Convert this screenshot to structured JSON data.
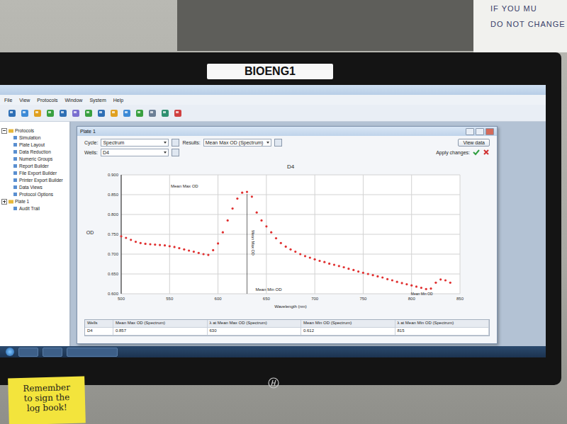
{
  "monitor_label": "BIOENG1",
  "wall_note": [
    "IF YOU MU",
    "DO NOT CHANGE"
  ],
  "menu": [
    "File",
    "View",
    "Protocols",
    "Window",
    "System",
    "Help"
  ],
  "tree": [
    {
      "label": "Protocols",
      "kind": "group",
      "expanded": true
    },
    {
      "label": "Simulation",
      "kind": "child"
    },
    {
      "label": "Plate Layout",
      "kind": "child"
    },
    {
      "label": "Data Reduction",
      "kind": "child"
    },
    {
      "label": "Numeric Groups",
      "kind": "child"
    },
    {
      "label": "Report Builder",
      "kind": "child"
    },
    {
      "label": "File Export Builder",
      "kind": "child"
    },
    {
      "label": "Printer Export Builder",
      "kind": "child"
    },
    {
      "label": "Data Views",
      "kind": "child"
    },
    {
      "label": "Protocol Options",
      "kind": "child"
    },
    {
      "label": "Plate 1",
      "kind": "group",
      "expanded": false
    },
    {
      "label": "Audit Trail",
      "kind": "child"
    }
  ],
  "plate_window": {
    "title": "Plate 1",
    "cycle_label": "Cycle:",
    "cycle_value": "Spectrum",
    "results_label": "Results:",
    "results_value": "Mean Max OD (Spectrum)",
    "wells_label": "Wells:",
    "wells_value": "D4",
    "view_data": "View data",
    "apply_label": "Apply changes:"
  },
  "chart": {
    "title": "D4",
    "y_label": "OD",
    "x_label": "Wavelength (nm)",
    "y_ticks": [
      "0.900",
      "0.850",
      "0.800",
      "0.750",
      "0.700",
      "0.650",
      "0.600"
    ],
    "x_ticks": [
      "500",
      "550",
      "600",
      "650",
      "700",
      "750",
      "800",
      "850"
    ],
    "annotations": {
      "max_top": "Mean Max OD",
      "max_line": "Mean Max OD",
      "min_axis": "Mean Min OD",
      "min_point": "Mean Min OD"
    },
    "series": [
      {
        "color": "#e03030",
        "x_start": 500,
        "x_step": 5,
        "values": [
          0.745,
          0.741,
          0.736,
          0.731,
          0.728,
          0.726,
          0.725,
          0.724,
          0.723,
          0.722,
          0.72,
          0.718,
          0.715,
          0.712,
          0.709,
          0.706,
          0.703,
          0.7,
          0.698,
          0.71,
          0.727,
          0.755,
          0.785,
          0.815,
          0.84,
          0.855,
          0.857,
          0.845,
          0.805,
          0.785,
          0.77,
          0.755,
          0.74,
          0.728,
          0.719,
          0.712,
          0.706,
          0.7,
          0.695,
          0.691,
          0.687,
          0.683,
          0.68,
          0.676,
          0.673,
          0.67,
          0.667,
          0.663,
          0.66,
          0.656,
          0.653,
          0.65,
          0.647,
          0.644,
          0.641,
          0.637,
          0.634,
          0.63,
          0.627,
          0.624,
          0.621,
          0.618,
          0.615,
          0.612,
          0.613,
          0.628,
          0.636,
          0.634,
          0.628
        ]
      }
    ]
  },
  "table": {
    "columns": [
      "Wells",
      "Mean Max OD (Spectrum)",
      "λ at Mean Max OD (Spectrum)",
      "Mean Min OD (Spectrum)",
      "λ at Mean Min OD (Spectrum)"
    ],
    "rows": [
      [
        "D4",
        "0.857",
        "630",
        "0.612",
        "815"
      ]
    ]
  },
  "sticky_note": {
    "lines": [
      "Remember",
      "to sign the",
      "log book!"
    ]
  }
}
